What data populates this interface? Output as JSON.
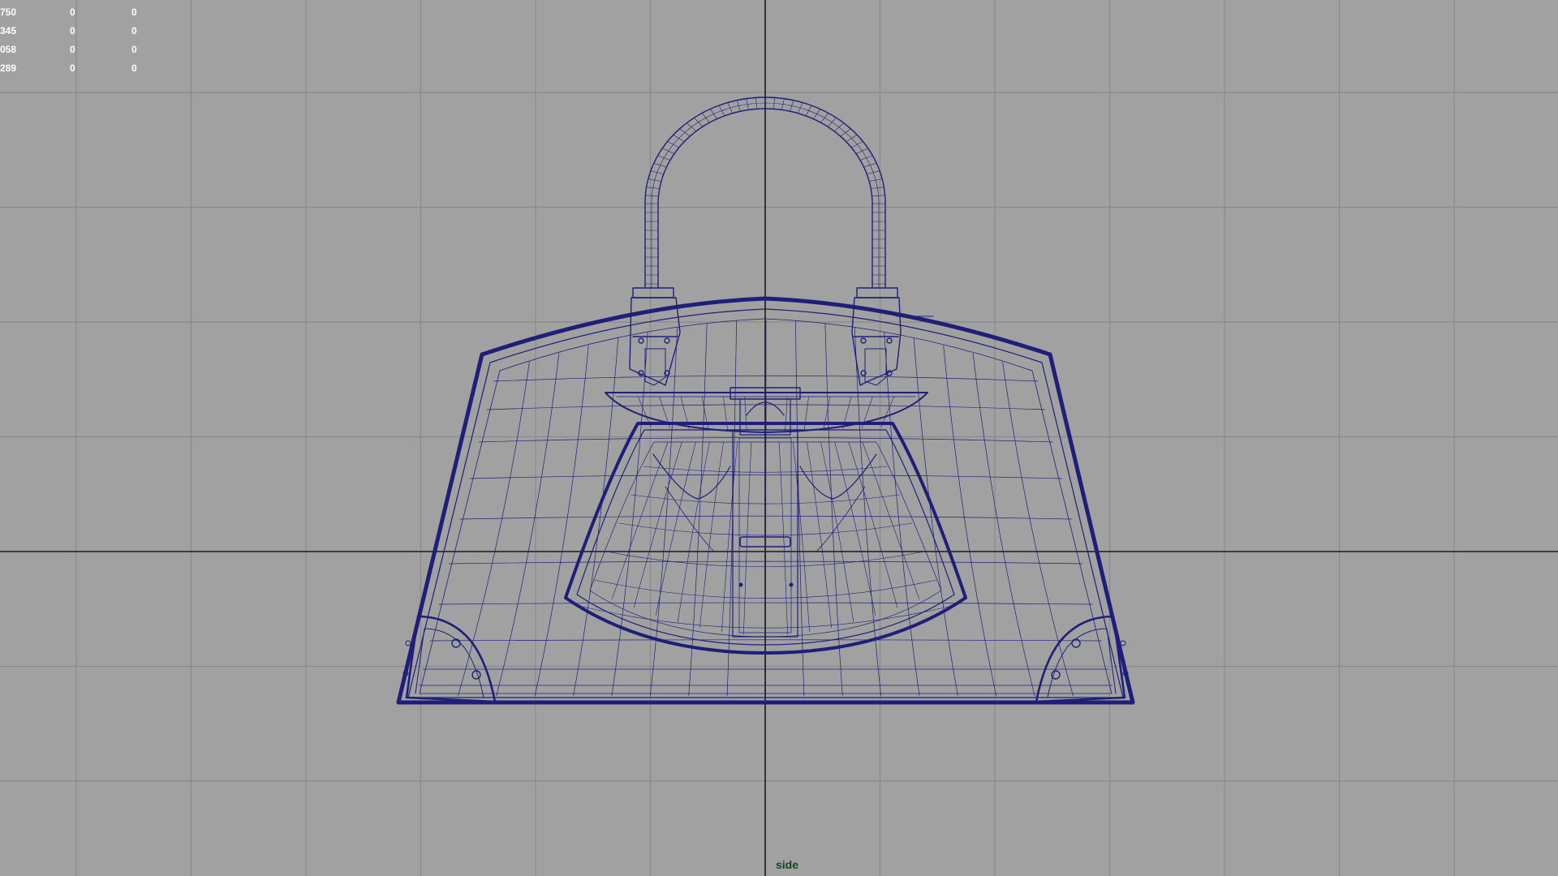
{
  "viewport": {
    "camera_name": "side",
    "colors": {
      "background": "#a1a1a1",
      "grid": "#8a8a8a",
      "axis": "#1a1a1a",
      "wireframe": "#1f1f7a",
      "hud_text": "#ffffff",
      "camera_label": "#0d4a1a"
    }
  },
  "hud": {
    "rows": [
      [
        "750",
        "0",
        "0"
      ],
      [
        "345",
        "0",
        "0"
      ],
      [
        "058",
        "0",
        "0"
      ],
      [
        "289",
        "0",
        "0"
      ]
    ]
  },
  "model": {
    "subject": "handbag-wireframe"
  }
}
